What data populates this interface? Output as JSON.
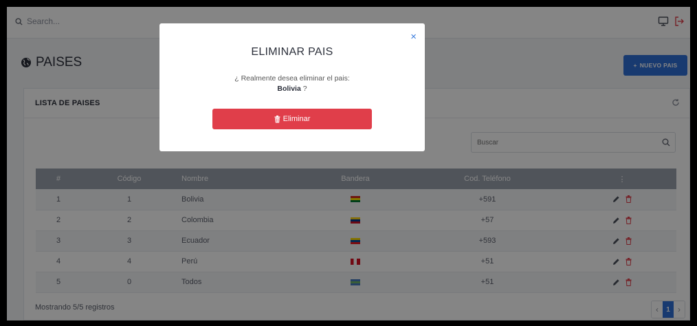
{
  "topbar": {
    "search_placeholder": "Search...",
    "icons": [
      "search-icon",
      "monitor-icon",
      "logout-icon"
    ]
  },
  "page": {
    "title": "PAISES",
    "title_icon": "globe-icon",
    "new_button": "NUEVO PAIS"
  },
  "card": {
    "title": "LISTA DE PAISES",
    "search_placeholder": "Buscar",
    "columns": [
      "#",
      "Código",
      "Nombre",
      "Bandera",
      "Cod. Teléfono",
      "⋮"
    ],
    "rows": [
      {
        "num": "1",
        "code": "1",
        "name": "Bolivia",
        "phone": "+591",
        "flag_colors": [
          "#d52b1e",
          "#f9e300",
          "#007934"
        ]
      },
      {
        "num": "2",
        "code": "2",
        "name": "Colombia",
        "phone": "+57",
        "flag_colors": [
          "#fcd116",
          "#003893",
          "#ce1126"
        ]
      },
      {
        "num": "3",
        "code": "3",
        "name": "Ecuador",
        "phone": "+593",
        "flag_colors": [
          "#ffdd00",
          "#034ea2",
          "#ed1c24"
        ]
      },
      {
        "num": "4",
        "code": "4",
        "name": "Perú",
        "phone": "+51",
        "flag_colors": [
          "#d91023",
          "#ffffff",
          "#d91023"
        ]
      },
      {
        "num": "5",
        "code": "0",
        "name": "Todos",
        "phone": "+51",
        "flag_colors": [
          "#4a7bbf",
          "#6fb46a",
          "#4a7bbf"
        ]
      }
    ],
    "footer": "Mostrando 5/5 registros",
    "pagination": {
      "prev": "‹",
      "current": "1",
      "next": "›"
    }
  },
  "modal": {
    "title": "ELIMINAR PAIS",
    "message": "¿ Realmente desea eliminar el pais:",
    "country": "Bolivia",
    "suffix": " ?",
    "button": "Eliminar",
    "close": "×"
  },
  "colors": {
    "primary": "#2f6fd6",
    "danger": "#e03e4a",
    "table_header": "#9aa1ad"
  }
}
